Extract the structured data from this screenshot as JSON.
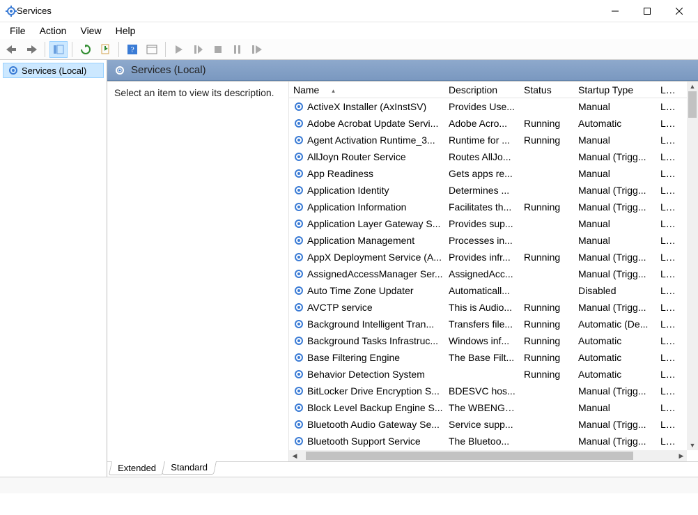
{
  "window": {
    "title": "Services"
  },
  "menu": {
    "file": "File",
    "action": "Action",
    "view": "View",
    "help": "Help"
  },
  "toolbar": {
    "back": "back",
    "forward": "forward",
    "showhide": "show-hide-tree",
    "export": "export-list",
    "refresh": "refresh",
    "help": "help",
    "properties": "properties",
    "start": "start",
    "resume": "resume",
    "stop": "stop",
    "pause": "pause",
    "restart": "restart"
  },
  "tree": {
    "root_label": "Services (Local)"
  },
  "pane": {
    "header": "Services (Local)",
    "description_placeholder": "Select an item to view its description."
  },
  "columns": {
    "name": "Name",
    "description": "Description",
    "status": "Status",
    "startup": "Startup Type",
    "logon": "Log On As"
  },
  "rows": [
    {
      "name": "ActiveX Installer (AxInstSV)",
      "desc": "Provides Use...",
      "status": "",
      "startup": "Manual",
      "logon": "Loc"
    },
    {
      "name": "Adobe Acrobat Update Servi...",
      "desc": "Adobe Acro...",
      "status": "Running",
      "startup": "Automatic",
      "logon": "Loc"
    },
    {
      "name": "Agent Activation Runtime_3...",
      "desc": "Runtime for ...",
      "status": "Running",
      "startup": "Manual",
      "logon": "Loc"
    },
    {
      "name": "AllJoyn Router Service",
      "desc": "Routes AllJo...",
      "status": "",
      "startup": "Manual (Trigg...",
      "logon": "Loc"
    },
    {
      "name": "App Readiness",
      "desc": "Gets apps re...",
      "status": "",
      "startup": "Manual",
      "logon": "Loc"
    },
    {
      "name": "Application Identity",
      "desc": "Determines ...",
      "status": "",
      "startup": "Manual (Trigg...",
      "logon": "Loc"
    },
    {
      "name": "Application Information",
      "desc": "Facilitates th...",
      "status": "Running",
      "startup": "Manual (Trigg...",
      "logon": "Loc"
    },
    {
      "name": "Application Layer Gateway S...",
      "desc": "Provides sup...",
      "status": "",
      "startup": "Manual",
      "logon": "Loc"
    },
    {
      "name": "Application Management",
      "desc": "Processes in...",
      "status": "",
      "startup": "Manual",
      "logon": "Loc"
    },
    {
      "name": "AppX Deployment Service (A...",
      "desc": "Provides infr...",
      "status": "Running",
      "startup": "Manual (Trigg...",
      "logon": "Loc"
    },
    {
      "name": "AssignedAccessManager Ser...",
      "desc": "AssignedAcc...",
      "status": "",
      "startup": "Manual (Trigg...",
      "logon": "Loc"
    },
    {
      "name": "Auto Time Zone Updater",
      "desc": "Automaticall...",
      "status": "",
      "startup": "Disabled",
      "logon": "Loc"
    },
    {
      "name": "AVCTP service",
      "desc": "This is Audio...",
      "status": "Running",
      "startup": "Manual (Trigg...",
      "logon": "Loc"
    },
    {
      "name": "Background Intelligent Tran...",
      "desc": "Transfers file...",
      "status": "Running",
      "startup": "Automatic (De...",
      "logon": "Loc"
    },
    {
      "name": "Background Tasks Infrastruc...",
      "desc": "Windows inf...",
      "status": "Running",
      "startup": "Automatic",
      "logon": "Loc"
    },
    {
      "name": "Base Filtering Engine",
      "desc": "The Base Filt...",
      "status": "Running",
      "startup": "Automatic",
      "logon": "Loc"
    },
    {
      "name": "Behavior Detection System",
      "desc": "",
      "status": "Running",
      "startup": "Automatic",
      "logon": "Loc"
    },
    {
      "name": "BitLocker Drive Encryption S...",
      "desc": "BDESVC hos...",
      "status": "",
      "startup": "Manual (Trigg...",
      "logon": "Loc"
    },
    {
      "name": "Block Level Backup Engine S...",
      "desc": "The WBENGI...",
      "status": "",
      "startup": "Manual",
      "logon": "Loc"
    },
    {
      "name": "Bluetooth Audio Gateway Se...",
      "desc": "Service supp...",
      "status": "",
      "startup": "Manual (Trigg...",
      "logon": "Loc"
    },
    {
      "name": "Bluetooth Support Service",
      "desc": "The Bluetoo...",
      "status": "",
      "startup": "Manual (Trigg...",
      "logon": "Loc"
    }
  ],
  "view_tabs": {
    "extended": "Extended",
    "standard": "Standard"
  }
}
